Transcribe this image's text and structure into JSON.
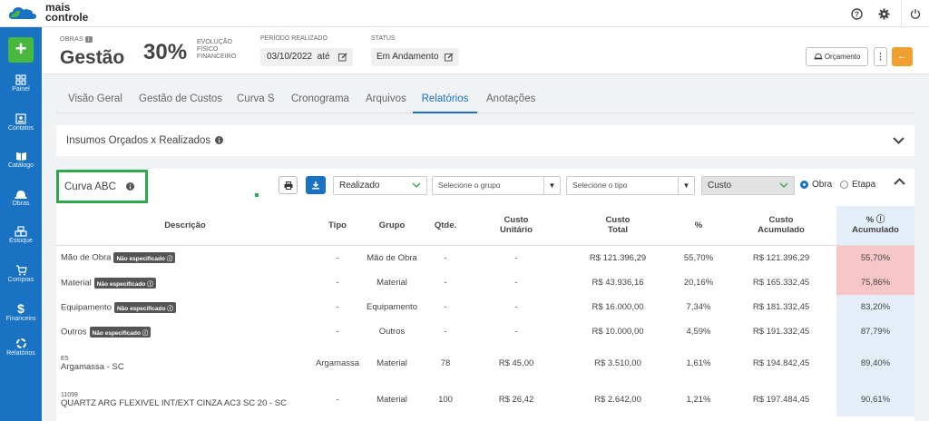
{
  "app": {
    "logo_line1": "mais",
    "logo_line2": "controle"
  },
  "sidebar": {
    "add_label": "+",
    "items": [
      {
        "label": "Painel",
        "icon": "grid-icon"
      },
      {
        "label": "Contatos",
        "icon": "contacts-icon"
      },
      {
        "label": "Catálogo",
        "icon": "book-icon"
      },
      {
        "label": "Obras",
        "icon": "helmet-icon"
      },
      {
        "label": "Estoque",
        "icon": "boxes-icon"
      },
      {
        "label": "Compras",
        "icon": "cart-icon"
      },
      {
        "label": "Financeiro",
        "icon": "dollar-icon"
      },
      {
        "label": "Relatórios",
        "icon": "chart-ring-icon"
      }
    ]
  },
  "header": {
    "obras_label": "OBRAS",
    "obras_badge": "i",
    "title": "Gestão",
    "percent": "30%",
    "evol1": "EVOLUÇÃO",
    "evol2": "FÍSICO",
    "evol3": "FINANCEIRO",
    "periodo_label": "PERÍODO REALIZADO",
    "periodo_value": "03/10/2022  até",
    "status_label": "STATUS",
    "status_value": "Em Andamento",
    "orcamento_label": "Orçamento",
    "kebab": "⋮",
    "back": "←"
  },
  "tabs": [
    "Visão Geral",
    "Gestão de Custos",
    "Curva S",
    "Cronograma",
    "Arquivos",
    "Relatórios",
    "Anotações"
  ],
  "active_tab": "Relatórios",
  "panel1": {
    "title": "Insumos Orçados x Realizados"
  },
  "panel2": {
    "title": "Curva ABC",
    "filters": {
      "mode": "Realizado",
      "group_placeholder": "Selecione o grupo",
      "type_placeholder": "Selecione o tipo",
      "metric": "Custo",
      "radio_obra": "Obra",
      "radio_etapa": "Etapa",
      "selected_radio": "Obra"
    },
    "columns": {
      "desc": "Descrição",
      "tipo": "Tipo",
      "grupo": "Grupo",
      "qtde": "Qtde.",
      "cu1": "Custo",
      "cu2": "Unitário",
      "ct1": "Custo",
      "ct2": "Total",
      "pct": "%",
      "ca1": "Custo",
      "ca2": "Acumulado",
      "pa1": "% ⓘ",
      "pa2": "Acumulado"
    },
    "rows": [
      {
        "code": "",
        "desc": "Mão de Obra",
        "tag": "Não especificado ⓘ",
        "tipo": "-",
        "grupo": "Mão de Obra",
        "qtde": "-",
        "unit": "-",
        "total": "R$ 121.396,29",
        "pct": "55,70%",
        "acc": "R$ 121.396,29",
        "pacc": "55,70%",
        "class": "A"
      },
      {
        "code": "",
        "desc": "Material",
        "tag": "Não especificado ⓘ",
        "tipo": "-",
        "grupo": "Material",
        "qtde": "-",
        "unit": "-",
        "total": "R$ 43.936,16",
        "pct": "20,16%",
        "acc": "R$ 165.332,45",
        "pacc": "75,86%",
        "class": "A"
      },
      {
        "code": "",
        "desc": "Equipamento",
        "tag": "Não especificado ⓘ",
        "tipo": "-",
        "grupo": "Equipamento",
        "qtde": "-",
        "unit": "-",
        "total": "R$ 16.000,00",
        "pct": "7,34%",
        "acc": "R$ 181.332,45",
        "pacc": "83,20%",
        "class": "B"
      },
      {
        "code": "",
        "desc": "Outros",
        "tag": "Não especificado ⓘ",
        "tipo": "-",
        "grupo": "Outros",
        "qtde": "-",
        "unit": "-",
        "total": "R$ 10.000,00",
        "pct": "4,59%",
        "acc": "R$ 191.332,45",
        "pacc": "87,79%",
        "class": "B"
      },
      {
        "code": "E5",
        "desc": "Argamassa - SC",
        "tag": "",
        "tipo": "Argamassa",
        "grupo": "Material",
        "qtde": "78",
        "unit": "R$ 45,00",
        "total": "R$ 3.510,00",
        "pct": "1,61%",
        "acc": "R$ 194.842,45",
        "pacc": "89,40%",
        "class": "B"
      },
      {
        "code": "11099",
        "desc": "QUARTZ ARG FLEXIVEL INT/EXT CINZA AC3 SC 20 - SC",
        "tag": "",
        "tipo": "-",
        "grupo": "Material",
        "qtde": "100",
        "unit": "R$ 26,42",
        "total": "R$ 2.642,00",
        "pct": "1,21%",
        "acc": "R$ 197.484,45",
        "pacc": "90,61%",
        "class": "B"
      }
    ]
  },
  "colors": {
    "brand_blue": "#1a72c2",
    "accent_green": "#48b83e",
    "class_a": "#f8c6c6",
    "class_b": "#e3eef9",
    "back_orange": "#f0a030"
  }
}
